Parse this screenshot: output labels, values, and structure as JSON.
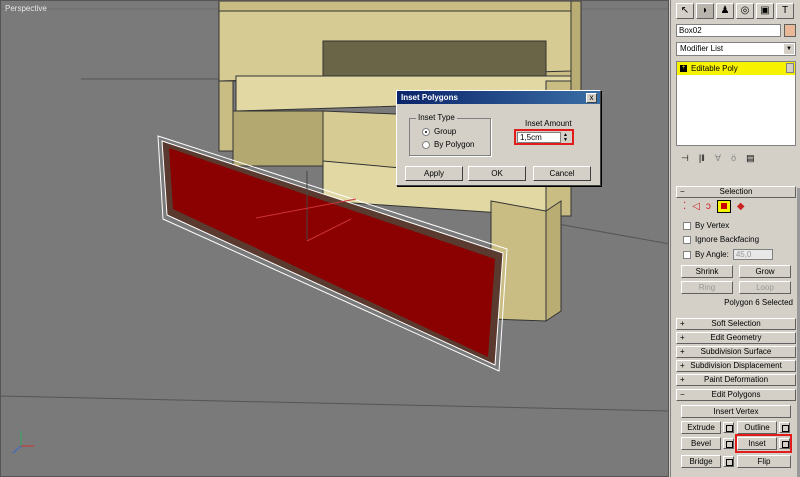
{
  "viewport": {
    "label": "Perspective"
  },
  "dialog": {
    "title": "Inset Polygons",
    "close": "x",
    "group_title": "Inset Type",
    "options": [
      "Group",
      "By Polygon"
    ],
    "selected": "Group",
    "amount_label": "Inset Amount",
    "amount_value": "1,5cm",
    "apply": "Apply",
    "ok": "OK",
    "cancel": "Cancel"
  },
  "panel": {
    "object_name": "Box02",
    "object_color": "#e8b897",
    "modifier_list": "Modifier List",
    "stack_item": "Editable Poly",
    "selection": {
      "title": "Selection",
      "by_vertex": "By Vertex",
      "ignore_backfacing": "Ignore Backfacing",
      "by_angle": "By Angle:",
      "angle_value": "45,0",
      "shrink": "Shrink",
      "grow": "Grow",
      "ring": "Ring",
      "loop": "Loop",
      "status": "Polygon 6 Selected"
    },
    "rollouts": [
      "Soft Selection",
      "Edit Geometry",
      "Subdivision Surface",
      "Subdivision Displacement",
      "Paint Deformation",
      "Edit Polygons"
    ],
    "edit_polygons": {
      "insert_vertex": "Insert Vertex",
      "extrude": "Extrude",
      "outline": "Outline",
      "bevel": "Bevel",
      "inset": "Inset",
      "bridge": "Bridge",
      "flip": "Flip"
    }
  },
  "colors": {
    "selected_face": "#8b0000",
    "highlight": "#e21b1b",
    "cabinet": "#d6cb92"
  }
}
